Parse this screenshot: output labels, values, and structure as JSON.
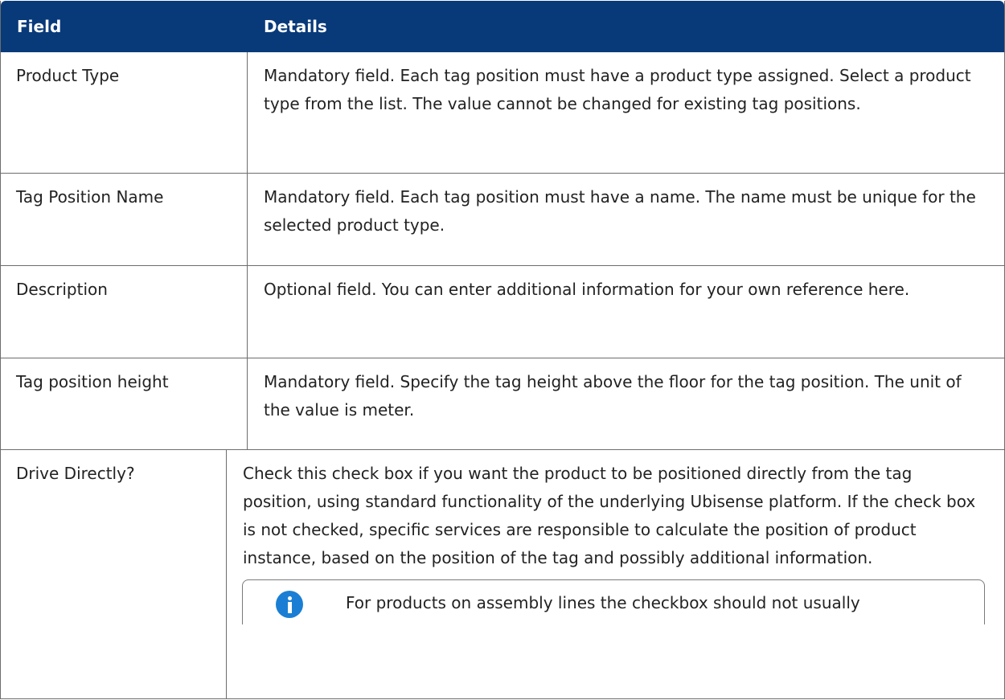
{
  "table": {
    "headers": {
      "field": "Field",
      "details": "Details"
    },
    "rows": [
      {
        "field": "Product Type",
        "details": "Mandatory field. Each tag position must have a product type assigned. Select a product type from the list. The value cannot be changed for existing tag positions."
      },
      {
        "field": "Tag Position Name",
        "details": "Mandatory field. Each tag position must have a name. The name must be unique for the selected product type."
      },
      {
        "field": "Description",
        "details": "Optional field. You can enter additional information for your own reference here."
      },
      {
        "field": "Tag position height",
        "details": "Mandatory field. Specify the tag height above the floor for the tag position. The unit of the value is meter."
      },
      {
        "field": "Drive Directly?",
        "details": "Check this check box if you want the product to be positioned directly from the tag position, using standard functionality of the underlying Ubisense platform. If the check box is not checked, specific services are responsible to calculate the position of product instance, based on the position of the tag and possibly additional information.",
        "note": {
          "icon": "info-icon",
          "text": "For products on assembly lines the checkbox should not usually"
        }
      }
    ]
  },
  "colors": {
    "header_bg": "#083a7a",
    "header_text": "#ffffff",
    "border": "#6d6d6d",
    "info_icon": "#1a7fd4"
  }
}
